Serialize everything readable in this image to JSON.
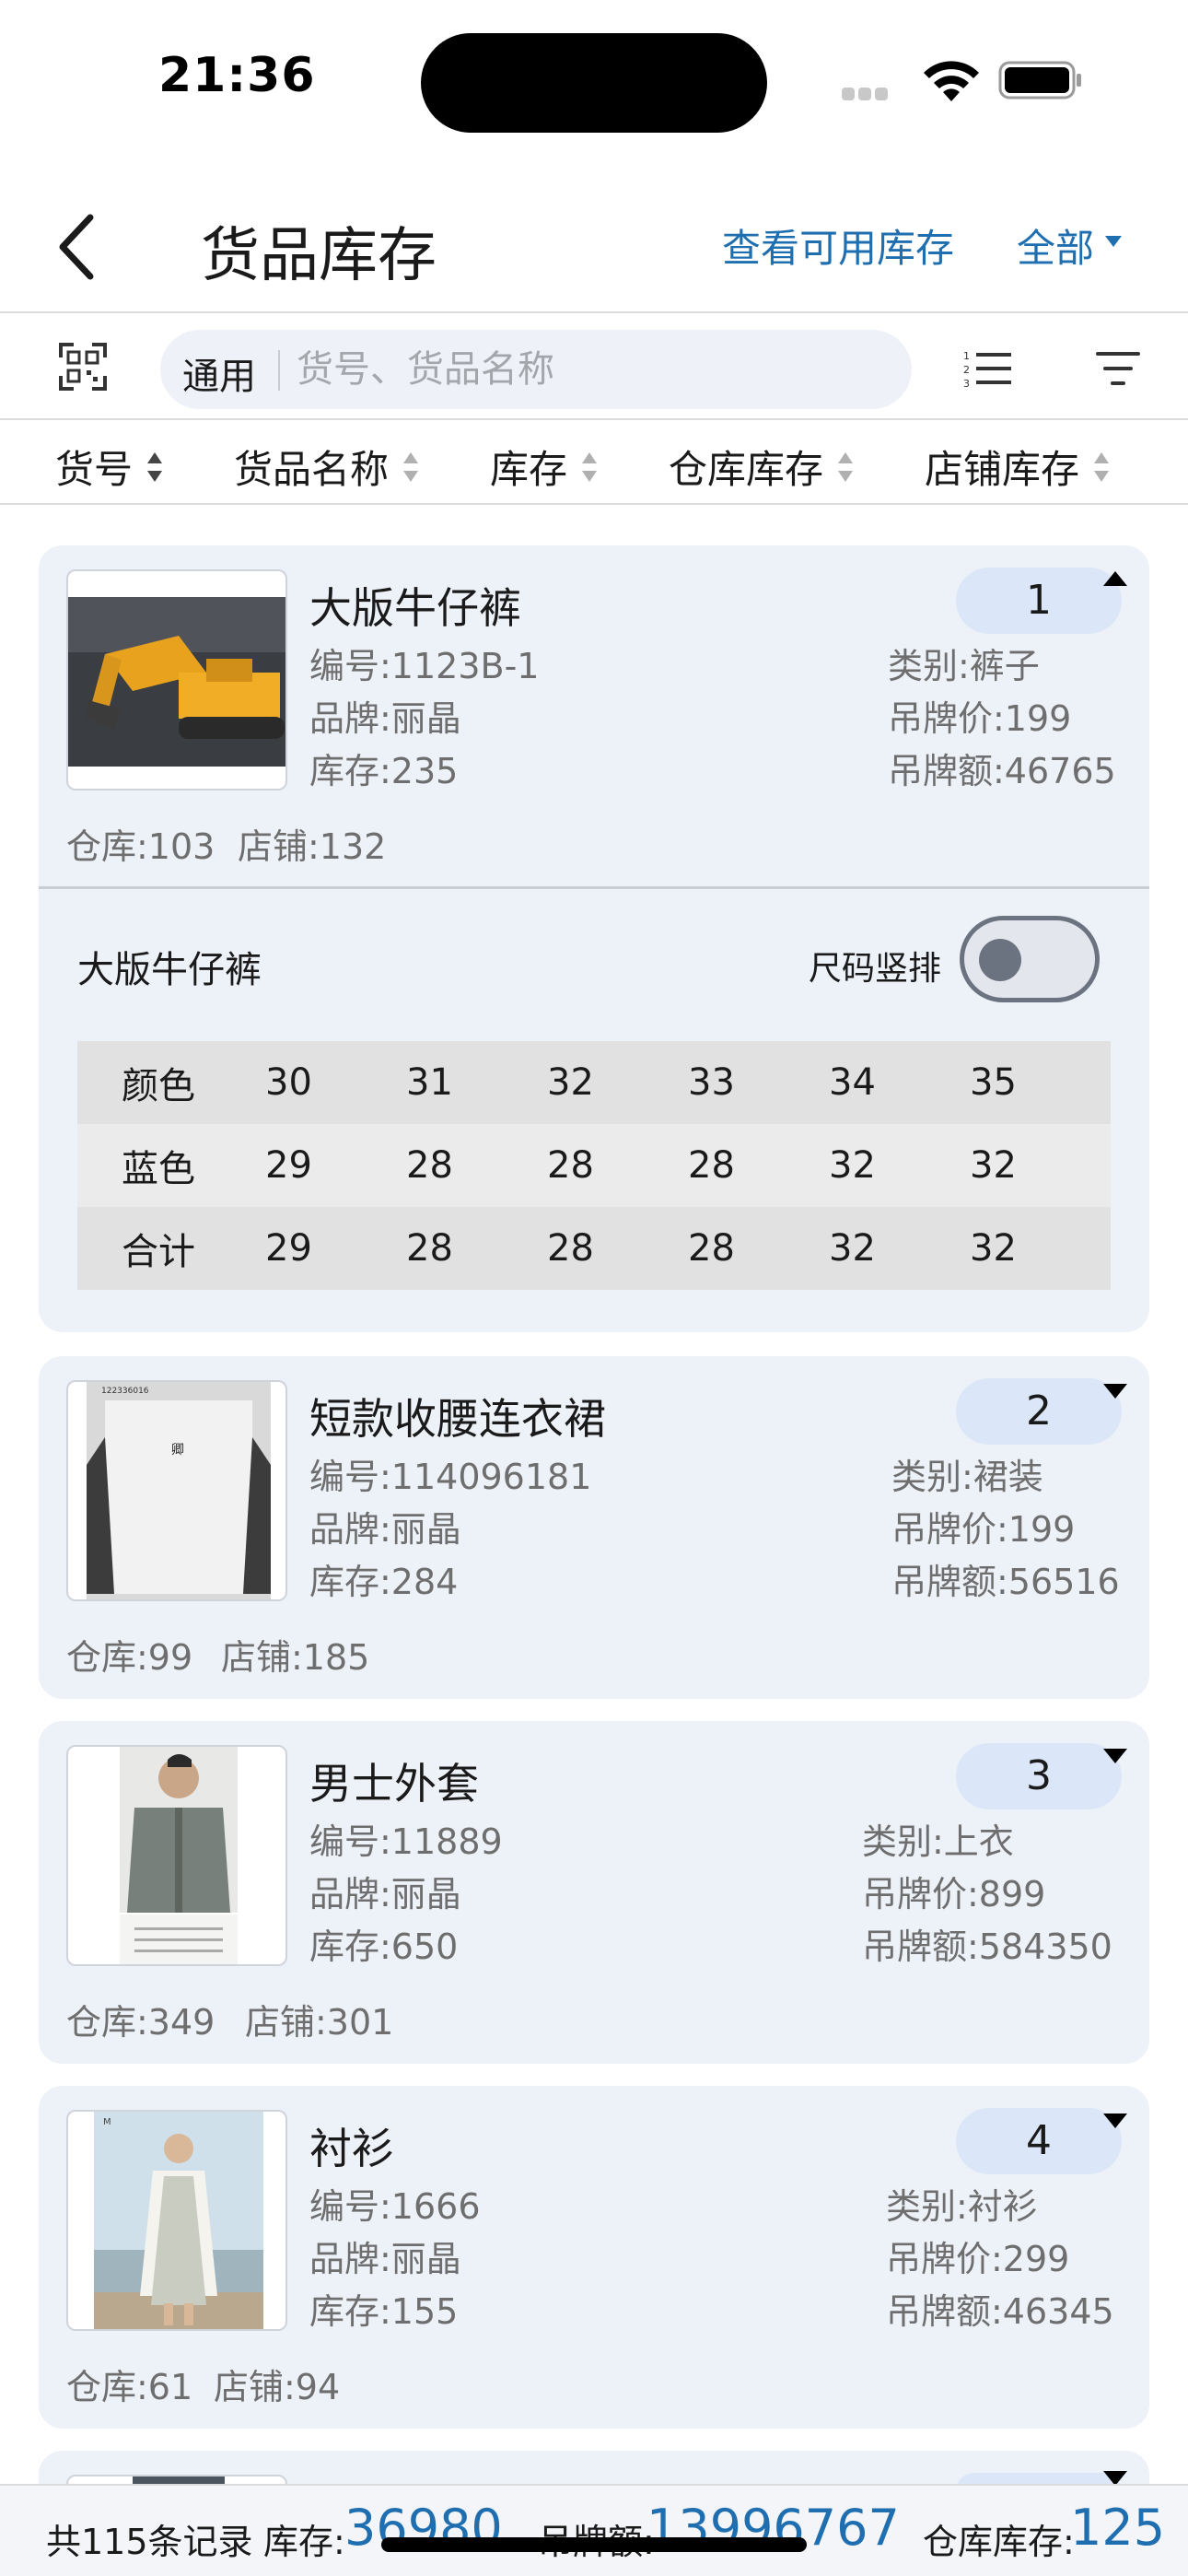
{
  "status_bar": {
    "time": "21:36"
  },
  "nav": {
    "title": "货品库存",
    "view_available": "查看可用库存",
    "scope": "全部"
  },
  "search": {
    "mode": "通用",
    "placeholder": "货号、货品名称"
  },
  "sort_columns": [
    "货号",
    "货品名称",
    "库存",
    "仓库库存",
    "店铺库存"
  ],
  "products": [
    {
      "index": "1",
      "name": "大版牛仔裤",
      "code": "编号:1123B-1",
      "brand": "品牌:丽晶",
      "stock": "库存:235",
      "category": "类别:裤子",
      "tag_price": "吊牌价:199",
      "tag_amount": "吊牌额:46765",
      "warehouse": "仓库:103",
      "store": "店铺:132",
      "expanded": true
    },
    {
      "index": "2",
      "name": "短款收腰连衣裙",
      "code": "编号:114096181",
      "brand": "品牌:丽晶",
      "stock": "库存:284",
      "category": "类别:裙装",
      "tag_price": "吊牌价:199",
      "tag_amount": "吊牌额:56516",
      "warehouse": "仓库:99",
      "store": "店铺:185",
      "expanded": false
    },
    {
      "index": "3",
      "name": "男士外套",
      "code": "编号:11889",
      "brand": "品牌:丽晶",
      "stock": "库存:650",
      "category": "类别:上衣",
      "tag_price": "吊牌价:899",
      "tag_amount": "吊牌额:584350",
      "warehouse": "仓库:349",
      "store": "店铺:301",
      "expanded": false
    },
    {
      "index": "4",
      "name": "衬衫",
      "code": "编号:1666",
      "brand": "品牌:丽晶",
      "stock": "库存:155",
      "category": "类别:衬衫",
      "tag_price": "吊牌价:299",
      "tag_amount": "吊牌额:46345",
      "warehouse": "仓库:61",
      "store": "店铺:94",
      "expanded": false
    }
  ],
  "detail": {
    "name": "大版牛仔裤",
    "toggle_label": "尺码竖排",
    "toggle_on": false,
    "header": [
      "颜色",
      "30",
      "31",
      "32",
      "33",
      "34",
      "35"
    ],
    "rows": [
      [
        "蓝色",
        "29",
        "28",
        "28",
        "28",
        "32",
        "32"
      ],
      [
        "合计",
        "29",
        "28",
        "28",
        "28",
        "32",
        "32"
      ]
    ]
  },
  "thumb_captions": {
    "p2": "122336016"
  },
  "summary": {
    "records": "共115条记录",
    "stock_label": "库存:",
    "stock_value": "36980",
    "amount_label": "吊牌额:",
    "amount_value": "13996767",
    "warehouse_label": "仓库库存:",
    "warehouse_value": "125"
  },
  "colors": {
    "accent": "#1f6fb0",
    "card_bg": "#edf1f8",
    "badge_bg": "#dbe6f8"
  }
}
